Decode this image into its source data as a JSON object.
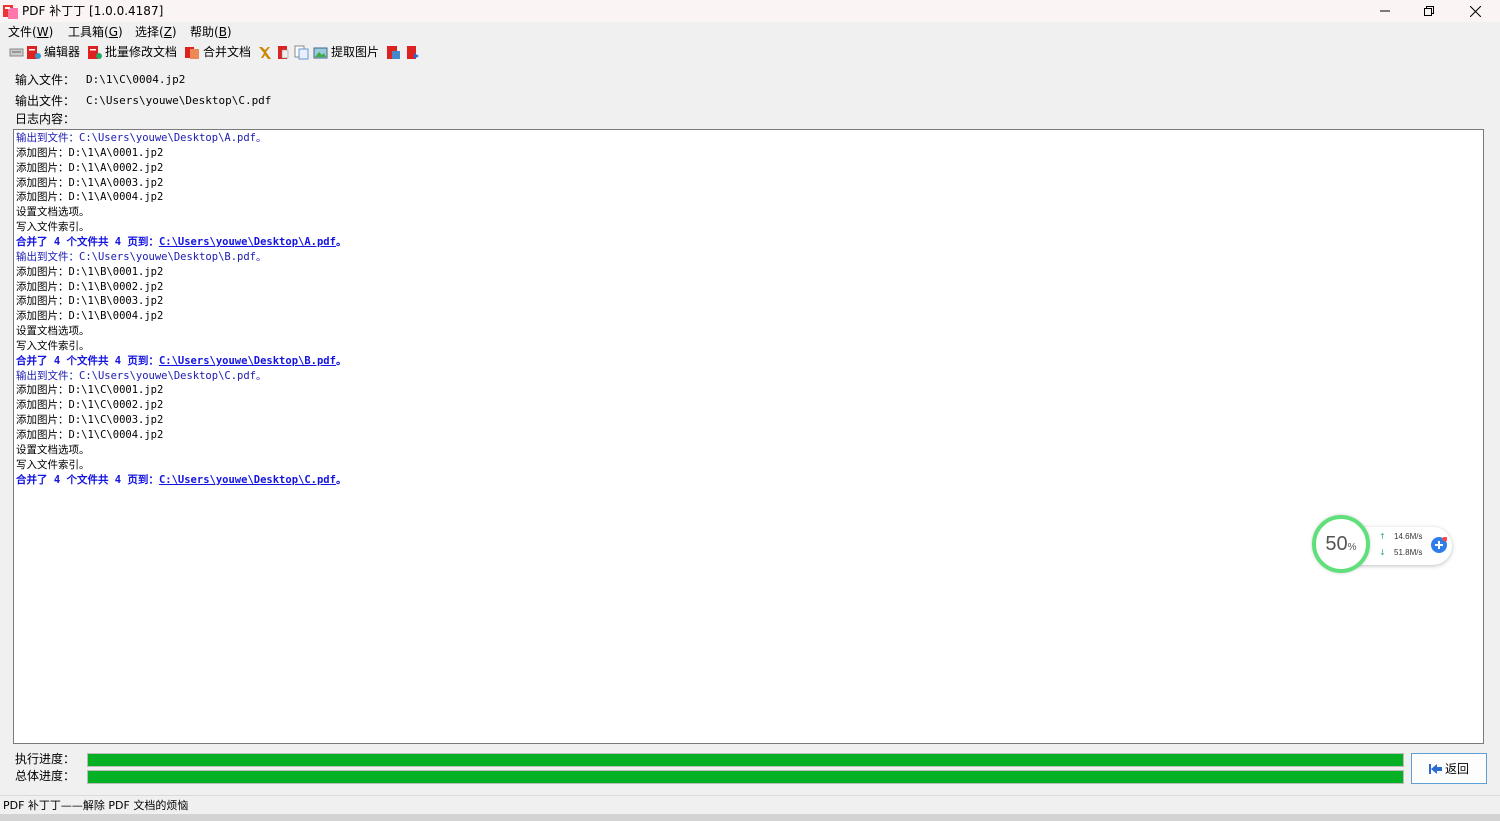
{
  "window": {
    "title": "PDF 补丁丁 [1.0.0.4187]",
    "icons": [
      "app-icon",
      "minimize-icon",
      "restore-icon",
      "close-icon"
    ]
  },
  "menu": [
    {
      "label": "文件(",
      "key": "W",
      "suffix": ")"
    },
    {
      "label": "工具箱(",
      "key": "G",
      "suffix": ")"
    },
    {
      "label": "选择(",
      "key": "Z",
      "suffix": ")"
    },
    {
      "label": "帮助(",
      "key": "B",
      "suffix": ")"
    }
  ],
  "toolbar": {
    "editor": "编辑器",
    "batch_modify": "批量修改文档",
    "merge": "合并文档",
    "extract_images": "提取图片",
    "icons": [
      "tools-icon",
      "pdf-edit-icon",
      "pdf-batch-icon",
      "merge-icon",
      "rename-icon",
      "pdf-split-icon",
      "copy-icon",
      "image-extract-icon",
      "pdf-convert-icon",
      "pdf-export-icon"
    ]
  },
  "input": {
    "label": "输入文件：",
    "value": "D:\\1\\C\\0004.jp2"
  },
  "output": {
    "label": "输出文件：",
    "value": "C:\\Users\\youwe\\Desktop\\C.pdf"
  },
  "log": {
    "label": "日志内容：",
    "lines": [
      {
        "type": "head",
        "text": "输出到文件：C:\\Users\\youwe\\Desktop\\A.pdf。"
      },
      {
        "type": "normal",
        "text": "添加图片：D:\\1\\A\\0001.jp2"
      },
      {
        "type": "normal",
        "text": "添加图片：D:\\1\\A\\0002.jp2"
      },
      {
        "type": "normal",
        "text": "添加图片：D:\\1\\A\\0003.jp2"
      },
      {
        "type": "normal",
        "text": "添加图片：D:\\1\\A\\0004.jp2"
      },
      {
        "type": "normal",
        "text": "设置文档选项。"
      },
      {
        "type": "normal",
        "text": "写入文件索引。"
      },
      {
        "type": "bold",
        "text": "合并了 4 个文件共 4 页到：",
        "link": "C:\\Users\\youwe\\Desktop\\A.pdf",
        "end": "。"
      },
      {
        "type": "head",
        "text": "输出到文件：C:\\Users\\youwe\\Desktop\\B.pdf。"
      },
      {
        "type": "normal",
        "text": "添加图片：D:\\1\\B\\0001.jp2"
      },
      {
        "type": "normal",
        "text": "添加图片：D:\\1\\B\\0002.jp2"
      },
      {
        "type": "normal",
        "text": "添加图片：D:\\1\\B\\0003.jp2"
      },
      {
        "type": "normal",
        "text": "添加图片：D:\\1\\B\\0004.jp2"
      },
      {
        "type": "normal",
        "text": "设置文档选项。"
      },
      {
        "type": "normal",
        "text": "写入文件索引。"
      },
      {
        "type": "bold",
        "text": "合并了 4 个文件共 4 页到：",
        "link": "C:\\Users\\youwe\\Desktop\\B.pdf",
        "end": "。"
      },
      {
        "type": "head",
        "text": "输出到文件：C:\\Users\\youwe\\Desktop\\C.pdf。"
      },
      {
        "type": "normal",
        "text": "添加图片：D:\\1\\C\\0001.jp2"
      },
      {
        "type": "normal",
        "text": "添加图片：D:\\1\\C\\0002.jp2"
      },
      {
        "type": "normal",
        "text": "添加图片：D:\\1\\C\\0003.jp2"
      },
      {
        "type": "normal",
        "text": "添加图片：D:\\1\\C\\0004.jp2"
      },
      {
        "type": "normal",
        "text": "设置文档选项。"
      },
      {
        "type": "normal",
        "text": "写入文件索引。"
      },
      {
        "type": "bold",
        "text": "合并了 4 个文件共 4 页到：",
        "link": "C:\\Users\\youwe\\Desktop\\C.pdf",
        "end": "。"
      }
    ]
  },
  "speed_widget": {
    "percent": "50",
    "percent_unit": "%",
    "upload": "14.6M/s",
    "download": "51.8M/s"
  },
  "progress": {
    "task_label": "执行进度：",
    "task_value": 1.0,
    "total_label": "总体进度：",
    "total_value": 1.0
  },
  "back_button": "返回",
  "status": "PDF 补丁丁——解除 PDF 文档的烦恼",
  "colors": {
    "progress": "#06b025",
    "link": "#1414e0",
    "log_head": "#1a1ab0"
  }
}
